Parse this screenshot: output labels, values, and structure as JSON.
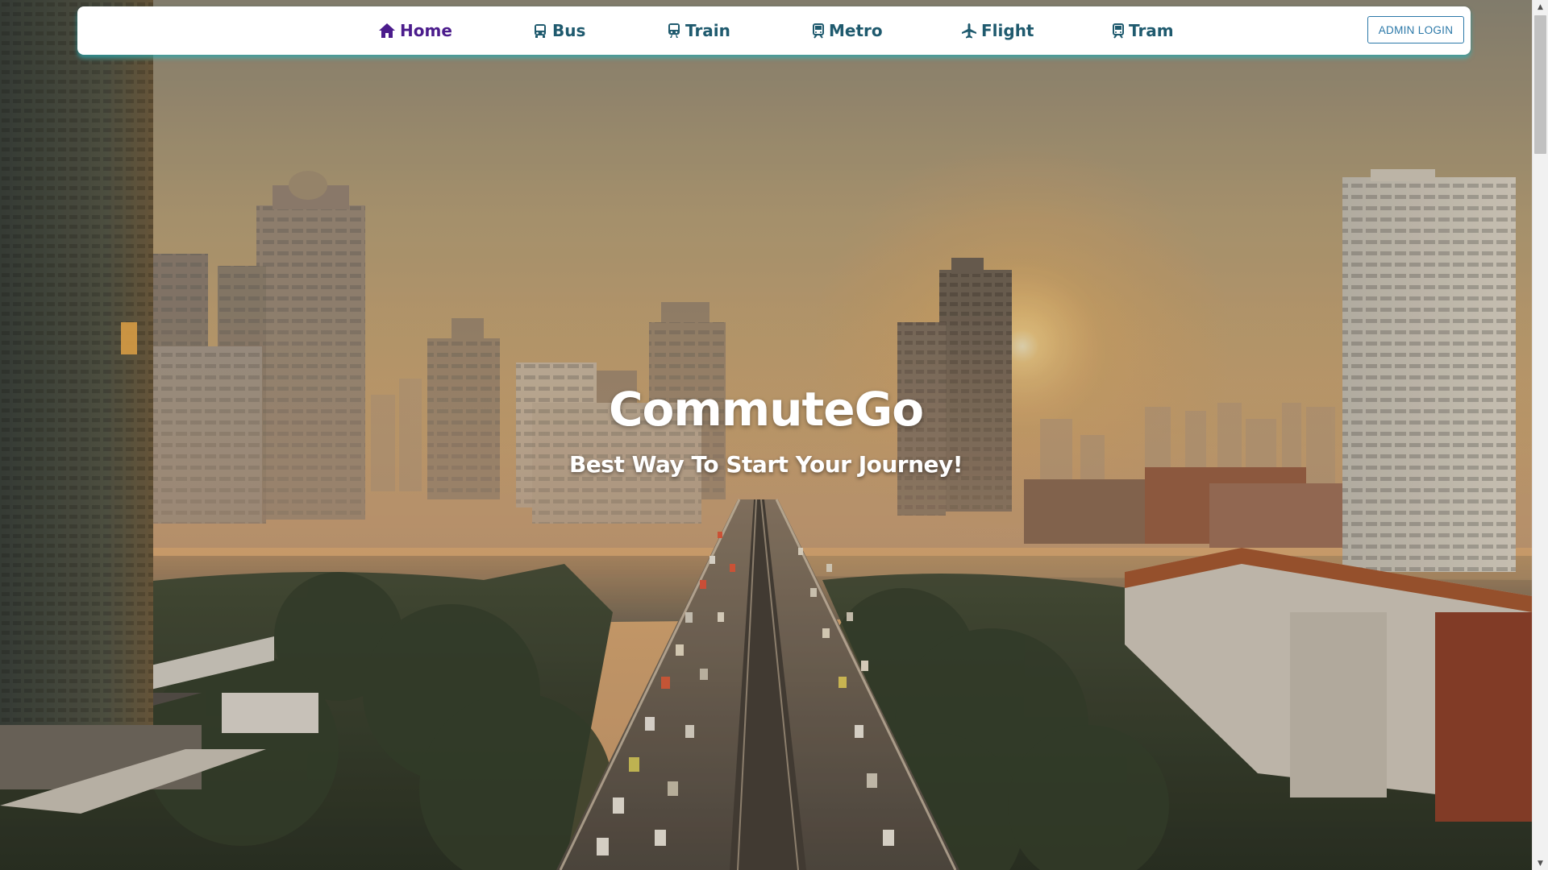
{
  "nav": {
    "items": [
      {
        "label": "Home",
        "icon": "home-icon",
        "active": true
      },
      {
        "label": "Bus",
        "icon": "bus-icon"
      },
      {
        "label": "Train",
        "icon": "train-icon"
      },
      {
        "label": "Metro",
        "icon": "metro-icon"
      },
      {
        "label": "Flight",
        "icon": "plane-icon"
      },
      {
        "label": "Tram",
        "icon": "tram-icon"
      }
    ],
    "admin_button": "ADMIN LOGIN"
  },
  "hero": {
    "title": "CommuteGo",
    "subtitle": "Best Way To Start Your Journey!",
    "background": "aerial city skyline at sunrise with river and highway"
  },
  "colors": {
    "nav_active": "#4b1c8c",
    "nav_text": "#1f5a6e",
    "nav_glow": "#28bec8",
    "admin_button": "#2b78a8"
  },
  "scroll": {
    "position": 0
  }
}
